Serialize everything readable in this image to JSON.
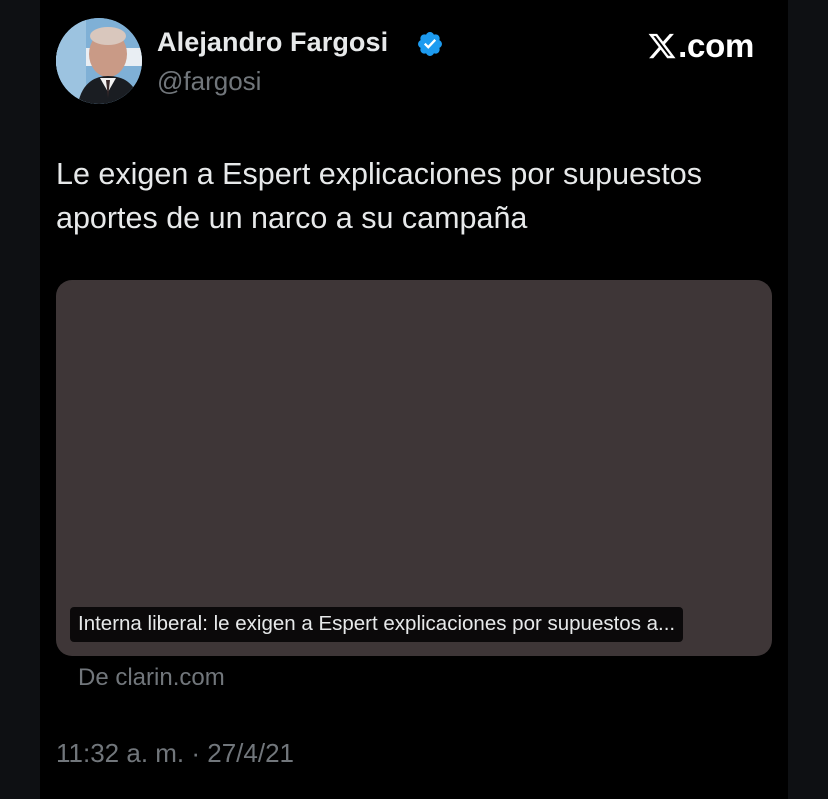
{
  "tweet": {
    "author": {
      "name": "Alejandro Fargosi",
      "handle": "@fargosi",
      "verified": true
    },
    "brand": ".com",
    "brand_icon": "x-logo-icon",
    "text": "Le exigen a Espert explicaciones por supuestos aportes de un narco a su campaña",
    "link_card": {
      "caption": "Interna liberal: le exigen a Espert explicaciones por supuestos a...",
      "source": "De clarin.com",
      "background": "#3e3637"
    },
    "time": "11:32 a. m.",
    "separator": " · ",
    "date": "27/4/21"
  },
  "colors": {
    "background": "#000000",
    "outer": "#0e1013",
    "text_primary": "#e7e9ea",
    "text_secondary": "#71767b",
    "verified_badge": "#1d9bf0"
  }
}
